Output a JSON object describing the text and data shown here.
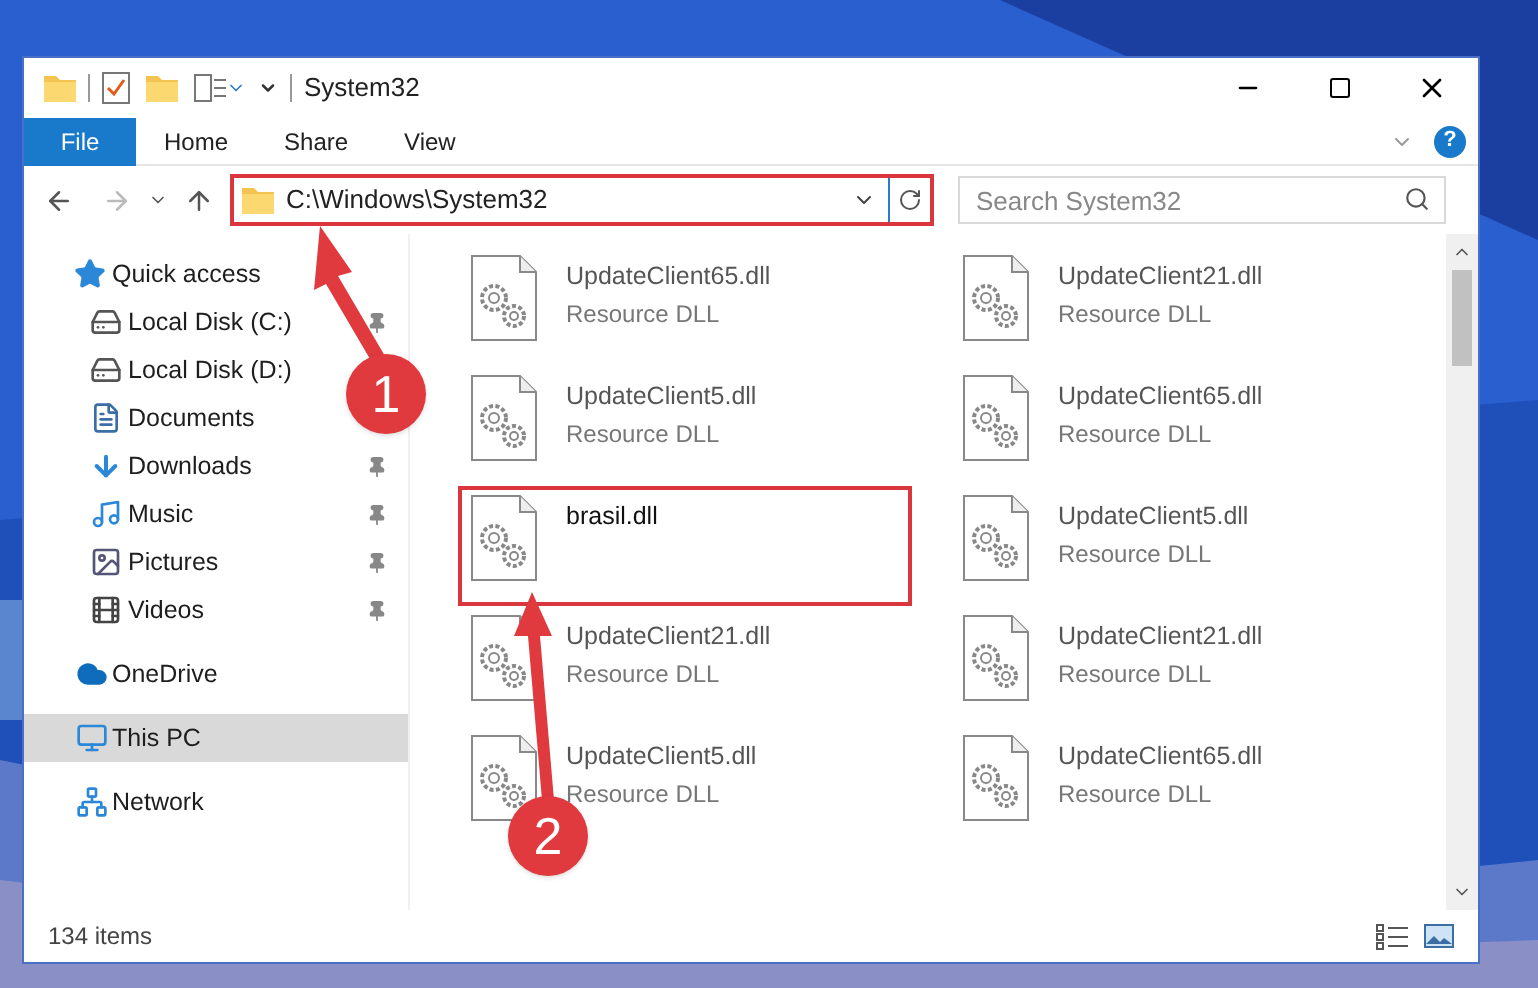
{
  "window": {
    "title": "System32"
  },
  "ribbon_tabs": [
    {
      "label": "File",
      "kind": "file"
    },
    {
      "label": "Home",
      "kind": "tab"
    },
    {
      "label": "Share",
      "kind": "tab"
    },
    {
      "label": "View",
      "kind": "tab"
    }
  ],
  "help": "?",
  "address_bar": {
    "path": "C:\\Windows\\System32"
  },
  "search": {
    "placeholder": "Search System32"
  },
  "sidebar": {
    "items": [
      {
        "label": "Quick access",
        "selected": false,
        "children": [
          {
            "label": "Local Disk (C:)",
            "pinned": true,
            "selected": false
          },
          {
            "label": "Local Disk (D:)",
            "pinned": false,
            "selected": false
          },
          {
            "label": "Documents",
            "pinned": false,
            "selected": false
          },
          {
            "label": "Downloads",
            "pinned": true,
            "selected": false
          },
          {
            "label": "Music",
            "pinned": true,
            "selected": false
          },
          {
            "label": "Pictures",
            "pinned": true,
            "selected": false
          },
          {
            "label": "Videos",
            "pinned": true,
            "selected": false
          }
        ]
      },
      {
        "label": "OneDrive",
        "selected": false
      },
      {
        "label": "This PC",
        "selected": true
      },
      {
        "label": "Network",
        "selected": false
      }
    ]
  },
  "files": [
    {
      "name": "UpdateClient65.dll",
      "type": "Resource DLL",
      "highlighted": false
    },
    {
      "name": "UpdateClient21.dll",
      "type": "Resource DLL",
      "highlighted": false
    },
    {
      "name": "UpdateClient5.dll",
      "type": "Resource DLL",
      "highlighted": false
    },
    {
      "name": "UpdateClient65.dll",
      "type": "Resource DLL",
      "highlighted": false
    },
    {
      "name": "brasil.dll",
      "highlighted": true
    },
    {
      "name": "UpdateClient5.dll",
      "type": "Resource DLL",
      "highlighted": false
    },
    {
      "name": "UpdateClient21.dll",
      "type": "Resource DLL",
      "highlighted": false
    },
    {
      "name": "UpdateClient21.dll",
      "type": "Resource DLL",
      "highlighted": false
    },
    {
      "name": "UpdateClient5.dll",
      "type": "Resource DLL",
      "highlighted": false
    },
    {
      "name": "UpdateClient65.dll",
      "type": "Resource DLL",
      "highlighted": false
    }
  ],
  "status_bar": {
    "item_count": "134 items"
  },
  "annotations": [
    {
      "label": "1"
    },
    {
      "label": "2"
    }
  ]
}
